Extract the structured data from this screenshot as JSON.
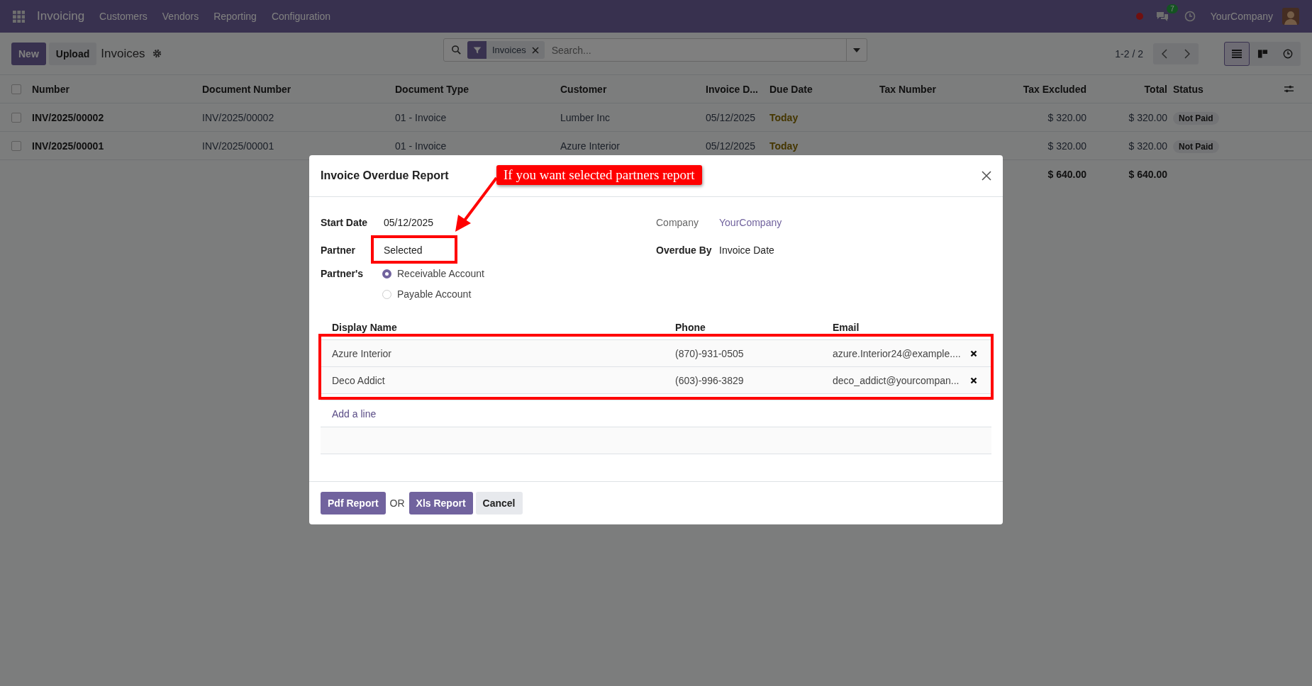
{
  "navbar": {
    "app_name": "Invoicing",
    "menu": [
      "Customers",
      "Vendors",
      "Reporting",
      "Configuration"
    ],
    "message_count": "7",
    "company": "YourCompany"
  },
  "control_panel": {
    "buttons": [
      "New",
      "Upload"
    ],
    "title": "Invoices",
    "facet": "Invoices",
    "placeholder": "Search...",
    "pager": "1-2 / 2",
    "views": [
      {
        "kind": "list",
        "selected": true
      },
      {
        "kind": "kanban",
        "selected": false
      },
      {
        "kind": "activity",
        "selected": false
      }
    ]
  },
  "table": {
    "select_all_checked": false,
    "columns": [
      "Number",
      "Document Number",
      "Document Type",
      "Customer",
      "Invoice D...",
      "Due Date",
      "Tax Number",
      "Tax Excluded",
      "Total",
      "Status"
    ],
    "rows": [
      {
        "checked": false,
        "number": "INV/2025/00002",
        "document_number": "INV/2025/00002",
        "document_type": "01 - Invoice",
        "customer": "Lumber Inc",
        "invoice_date": "05/12/2025",
        "due_date": "Today",
        "tax_excluded": "$ 320.00",
        "total": "$ 320.00",
        "status": "Not Paid"
      },
      {
        "checked": false,
        "number": "INV/2025/00001",
        "document_number": "INV/2025/00001",
        "document_type": "01 - Invoice",
        "customer": "Azure Interior",
        "invoice_date": "05/12/2025",
        "due_date": "Today",
        "tax_excluded": "$ 320.00",
        "total": "$ 320.00",
        "status": "Not Paid"
      }
    ],
    "totals": {
      "tax_excluded": "$ 640.00",
      "total": "$ 640.00"
    }
  },
  "dialog": {
    "title": "Invoice Overdue Report",
    "annotation": "If you want selected partners report",
    "start_date": {
      "label": "Start Date",
      "value": "05/12/2025"
    },
    "partner": {
      "label": "Partner",
      "value": "Selected"
    },
    "partners_account": {
      "label": "Partner's",
      "options": [
        {
          "label": "Receivable Account",
          "selected": true
        },
        {
          "label": "Payable Account",
          "selected": false
        }
      ]
    },
    "company": {
      "label": "Company",
      "value": "YourCompany"
    },
    "overdue_by": {
      "label": "Overdue By",
      "value": "Invoice Date"
    },
    "partner_table": {
      "columns": [
        "Display Name",
        "Phone",
        "Email"
      ],
      "rows": [
        {
          "name": "Azure Interior",
          "phone": "(870)-931-0505",
          "email": "azure.Interior24@example...."
        },
        {
          "name": "Deco Addict",
          "phone": "(603)-996-3829",
          "email": "deco_addict@yourcompan..."
        }
      ],
      "add_line": "Add a line"
    },
    "buttons": [
      {
        "label": "Pdf Report",
        "kind": "primary"
      },
      {
        "label": "Xls Report",
        "kind": "primary"
      },
      {
        "label": "Cancel",
        "kind": "secondary"
      }
    ],
    "separator": "OR"
  }
}
